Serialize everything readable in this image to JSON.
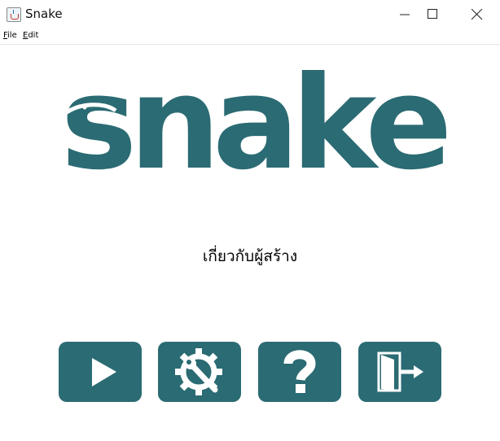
{
  "window": {
    "title": "Snake",
    "icon": "java-cup-icon",
    "controls": [
      "minimize-icon",
      "maximize-icon",
      "close-icon"
    ]
  },
  "menubar": {
    "file": {
      "mnemonic": "F",
      "rest": "ile"
    },
    "edit": {
      "mnemonic": "E",
      "rest": "dit"
    }
  },
  "logo": {
    "text": "snake"
  },
  "about_label": "เกี่ยวกับผู้สร้าง",
  "buttons": [
    {
      "icon": "play-icon"
    },
    {
      "icon": "gear-wrench-icon"
    },
    {
      "icon": "question-mark-icon"
    },
    {
      "icon": "exit-door-icon"
    }
  ],
  "colors": {
    "accent": "#2b6b73",
    "background": "#ffffff"
  }
}
